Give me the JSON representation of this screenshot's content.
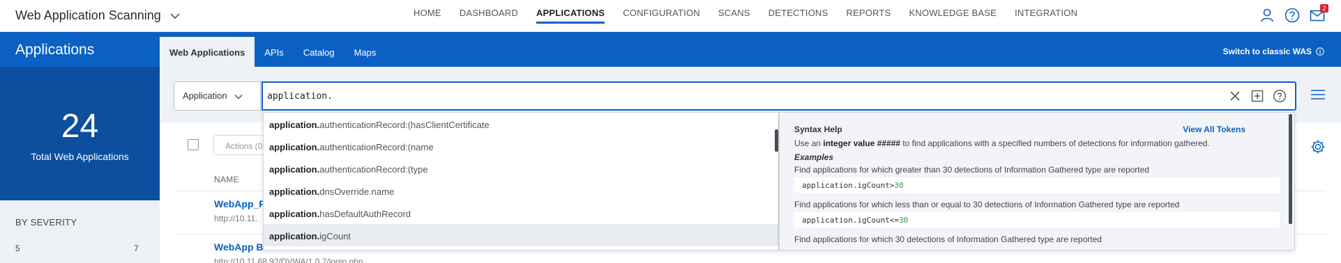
{
  "header": {
    "app_title": "Web Application Scanning",
    "nav": [
      "HOME",
      "DASHBOARD",
      "APPLICATIONS",
      "CONFIGURATION",
      "SCANS",
      "DETECTIONS",
      "REPORTS",
      "KNOWLEDGE BASE",
      "INTEGRATION"
    ],
    "active_nav": "APPLICATIONS",
    "notification_count": "2"
  },
  "left": {
    "title": "Applications",
    "total": "24",
    "total_label": "Total Web Applications",
    "severity_title": "BY SEVERITY",
    "severity_left": "5",
    "severity_right": "7"
  },
  "subnav": {
    "tabs": [
      "Web Applications",
      "APIs",
      "Catalog",
      "Maps"
    ],
    "active_tab": "Web Applications",
    "classic_link": "Switch to classic WAS"
  },
  "search": {
    "field": "Application",
    "query": "application."
  },
  "table": {
    "actions_label": "Actions (0",
    "col_name": "NAME",
    "rows": [
      {
        "title": "WebApp_F",
        "url": "http://10.11."
      },
      {
        "title": "WebApp B",
        "url": "http://10.11.68.92/DVWA/1.0.7/login.php"
      }
    ]
  },
  "autocomplete": {
    "prefix": "application.",
    "items": [
      "authenticationRecord:(hasClientCertificate",
      "authenticationRecord:(name",
      "authenticationRecord:(type",
      "dnsOverride.name",
      "hasDefaultAuthRecord",
      "igCount"
    ],
    "highlighted_index": 5
  },
  "syntax_help": {
    "title": "Syntax Help",
    "view_all": "View All Tokens",
    "desc_pre": "Use an ",
    "desc_bold": "integer value #####",
    "desc_post": " to find applications with a specified numbers of detections for information gathered.",
    "examples_label": "Examples",
    "ex1": "Find applications for which greater than 30 detections of Information Gathered type are reported",
    "code1_pre": "application.igCount>",
    "code1_num": "30",
    "ex2": "Find applications for which less than or equal to 30 detections of Information Gathered type are reported",
    "code2_pre": "application.igCount<=",
    "code2_num": "30",
    "ex3": "Find applications for which 30 detections of Information Gathered type are reported"
  }
}
